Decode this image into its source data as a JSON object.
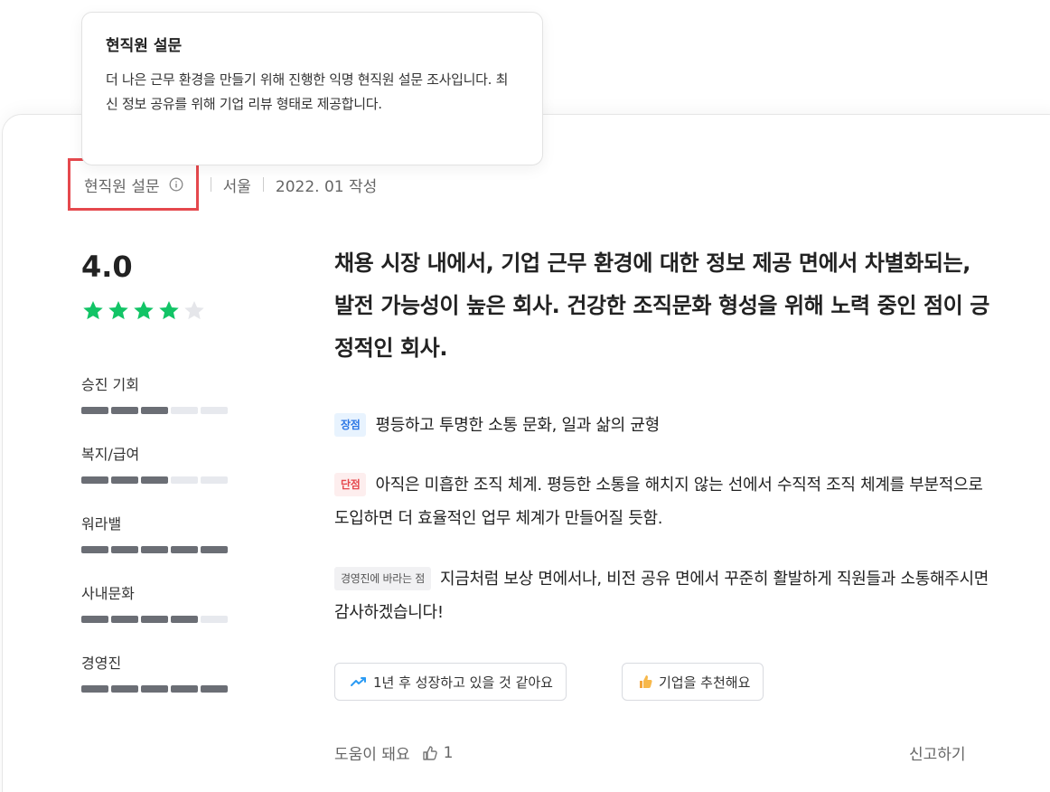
{
  "tooltip": {
    "title": "현직원 설문",
    "body": "더 나은 근무 환경을 만들기 위해 진행한 익명 현직원 설문 조사입니다. 최신 정보 공유를 위해 기업 리뷰 형태로 제공합니다."
  },
  "meta": {
    "survey_label": "현직원 설문",
    "location": "서울",
    "date": "2022. 01 작성"
  },
  "rating": {
    "score": "4.0",
    "stars_filled": 4,
    "stars_total": 5,
    "star_color": "#12c466",
    "star_empty_color": "#e5e6ea"
  },
  "categories": [
    {
      "label": "승진 기회",
      "level": 3,
      "max": 5
    },
    {
      "label": "복지/급여",
      "level": 3,
      "max": 5
    },
    {
      "label": "워라밸",
      "level": 5,
      "max": 5
    },
    {
      "label": "사내문화",
      "level": 4,
      "max": 5
    },
    {
      "label": "경영진",
      "level": 5,
      "max": 5
    }
  ],
  "review": {
    "headline": "채용 시장 내에서, 기업 근무 환경에 대한 정보 제공 면에서 차별화되는, 발전 가능성이 높은 회사. 건강한 조직문화 형성을 위해 노력 중인 점이 긍정적인 회사.",
    "pros_tag": "장점",
    "pros": "평등하고 투명한 소통 문화, 일과 삶의 균형",
    "cons_tag": "단점",
    "cons": "아직은 미흡한 조직 체계. 평등한 소통을 해치지 않는 선에서 수직적 조직 체계를 부분적으로 도입하면 더 효율적인 업무 체계가 만들어질 듯함.",
    "wish_tag": "경영진에 바라는 점",
    "wish": "지금처럼 보상 면에서나, 비전 공유 면에서 꾸준히 활발하게 직원들과 소통해주시면 감사하겠습니다!"
  },
  "chips": {
    "growth": "1년 후 성장하고 있을 것 같아요",
    "recommend": "기업을 추천해요"
  },
  "footer": {
    "helpful_label": "도움이 돼요",
    "helpful_count": "1",
    "report_label": "신고하기"
  },
  "icons": {
    "info": "info-icon",
    "trend": "trend-up-icon",
    "thumb": "thumbs-up-icon"
  }
}
